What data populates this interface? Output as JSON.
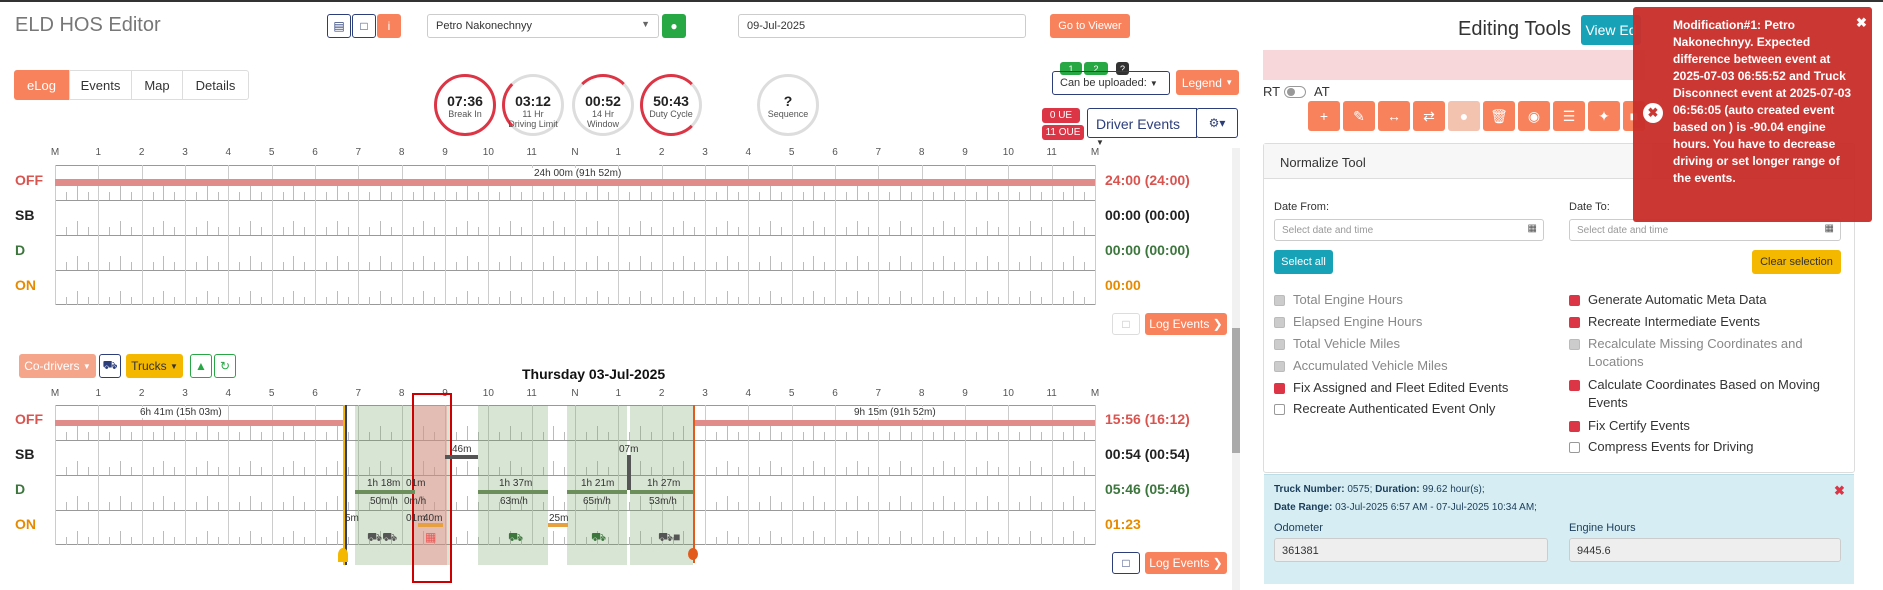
{
  "header": {
    "title": "ELD HOS Editor",
    "driver": "Petro Nakonechnyy",
    "date": "09-Jul-2025",
    "go_viewer": "Go to Viewer",
    "editing_tools": "Editing Tools",
    "view_btn": "View Ed"
  },
  "tabs": [
    "eLog",
    "Events",
    "Map",
    "Details"
  ],
  "circles": [
    {
      "value": "07:36",
      "label": "Break In",
      "color": "#dc3545",
      "pct": 0.95
    },
    {
      "value": "03:12",
      "label": "11 Hr\nDriving Limit",
      "color": "#dc3545",
      "pct": 0.3
    },
    {
      "value": "00:52",
      "label": "14 Hr\nWindow",
      "color": "#dc3545",
      "pct": 0.06
    },
    {
      "value": "50:43",
      "label": "Duty Cycle",
      "color": "#dc3545",
      "pct": 0.7
    },
    {
      "value": "?",
      "label": "Sequence",
      "color": "#ddd",
      "pct": 0
    }
  ],
  "right_controls": {
    "can_upload": "Can be uploaded:",
    "legend": "Legend",
    "ue": "0 UE",
    "oue": "11 OUE",
    "driver_events": "Driver Events",
    "badge1": "1",
    "badge2": "2",
    "badge3": "?"
  },
  "hours": [
    "M",
    "1",
    "2",
    "3",
    "4",
    "5",
    "6",
    "7",
    "8",
    "9",
    "10",
    "11",
    "N",
    "1",
    "2",
    "3",
    "4",
    "5",
    "6",
    "7",
    "8",
    "9",
    "10",
    "11",
    "M"
  ],
  "statuses": [
    "OFF",
    "SB",
    "D",
    "ON"
  ],
  "log1": {
    "totals": [
      "24:00 (24:00)",
      "00:00 (00:00)",
      "00:00 (00:00)",
      "00:00"
    ],
    "bar_label": "24h 00m (91h 52m)",
    "log_events": "Log Events"
  },
  "log2": {
    "date_title": "Thursday 03-Jul-2025",
    "totals": [
      "15:56 (16:12)",
      "00:54 (00:54)",
      "05:46 (05:46)",
      "01:23"
    ],
    "co_drivers": "Co-drivers",
    "trucks": "Trucks",
    "log_events": "Log Events",
    "labels": {
      "off_left": "6h 41m (15h 03m)",
      "off_right": "9h 15m (91h 52m)",
      "sb1": "46m",
      "sb2": "07m",
      "d1": "1h 18m",
      "d2": "01m",
      "d3": "1h 37m",
      "d4": "1h 21m",
      "d5": "1h 27m",
      "s1": "50m/h",
      "s2": "0m/h",
      "s3": "63m/h",
      "s4": "65m/h",
      "s5": "53m/h",
      "on1": "5m",
      "on2": "01m",
      "on3": "40m",
      "on4": "25m"
    }
  },
  "toggle": {
    "rt": "RT",
    "at": "AT"
  },
  "normalize": {
    "title": "Normalize Tool",
    "date_from": "Date From:",
    "date_to": "Date To:",
    "ph": "Select date and time",
    "select_all": "Select all",
    "clear": "Clear selection",
    "left_opts": [
      "Total Engine Hours",
      "Elapsed Engine Hours",
      "Total Vehicle Miles",
      "Accumulated Vehicle Miles",
      "Fix Assigned and Fleet Edited Events",
      "Recreate Authenticated Event Only"
    ],
    "right_opts": [
      "Generate Automatic Meta Data",
      "Recreate Intermediate Events",
      "Recalculate Missing Coordinates and Locations",
      "Calculate Coordinates Based on Moving Events",
      "Fix Certify Events",
      "Compress Events for Driving"
    ]
  },
  "truck": {
    "number_lbl": "Truck Number:",
    "number": "0575",
    "duration_lbl": "Duration:",
    "duration": "99.62 hour(s);",
    "range_lbl": "Date Range:",
    "range": "03-Jul-2025 6:57 AM - 07-Jul-2025 10:34 AM;",
    "odo_lbl": "Odometer",
    "odo": "361381",
    "eh_lbl": "Engine Hours",
    "eh": "9445.6"
  },
  "toast": {
    "text": "Modification#1: Petro Nakonechnyy. Expected difference between event at 2025-07-03 06:55:52 and Truck Disconnect event at 2025-07-03 06:56:05 (auto created event based on ) is -90.04 engine hours. You have to decrease driving or set longer range of the events."
  },
  "colors": {
    "off": "#d9534f",
    "sb": "#222",
    "d": "#3c763d",
    "on": "#e68a00",
    "accent": "#f7825c"
  }
}
